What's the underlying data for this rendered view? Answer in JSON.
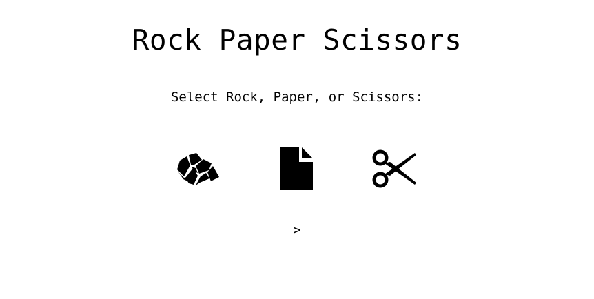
{
  "game": {
    "title": "Rock Paper Scissors",
    "instructions": "Select Rock, Paper, or Scissors:",
    "choices": [
      {
        "id": "rock",
        "icon": "rock-icon"
      },
      {
        "id": "paper",
        "icon": "paper-icon"
      },
      {
        "id": "scissors",
        "icon": "scissors-icon"
      }
    ],
    "result": ">"
  },
  "colors": {
    "background": "#ffffff",
    "text": "#000000",
    "icon": "#000000"
  }
}
